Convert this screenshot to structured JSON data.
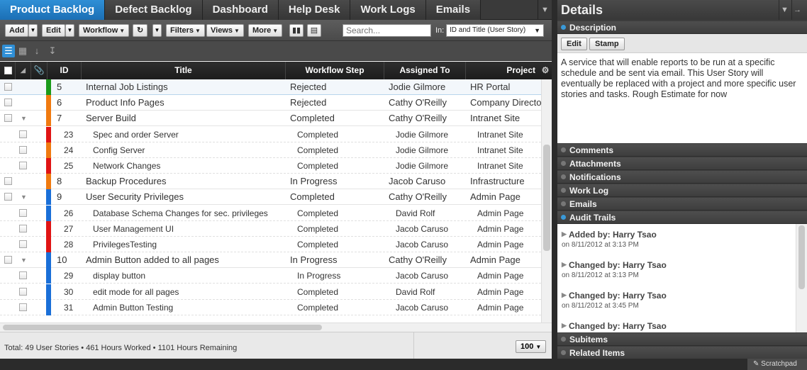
{
  "tabs": [
    {
      "label": "Product Backlog",
      "active": true
    },
    {
      "label": "Defect Backlog",
      "active": false
    },
    {
      "label": "Dashboard",
      "active": false
    },
    {
      "label": "Help Desk",
      "active": false
    },
    {
      "label": "Work Logs",
      "active": false
    },
    {
      "label": "Emails",
      "active": false
    }
  ],
  "toolbar": {
    "add": "Add",
    "edit": "Edit",
    "workflow": "Workflow",
    "filters": "Filters",
    "views": "Views",
    "more": "More",
    "search_placeholder": "Search...",
    "in_label": "In:",
    "in_value": "ID and Title (User Story)"
  },
  "columns": {
    "id": "ID",
    "title": "Title",
    "workflow": "Workflow Step",
    "assigned": "Assigned To",
    "project": "Project"
  },
  "rows": [
    {
      "id": "5",
      "title": "Internal Job Listings",
      "step": "Rejected",
      "assigned": "Jodie Gilmore",
      "project": "HR Portal",
      "color": "#1a9a1a",
      "child": false,
      "expandable": false,
      "selected": true
    },
    {
      "id": "6",
      "title": "Product Info Pages",
      "step": "Rejected",
      "assigned": "Cathy O'Reilly",
      "project": "Company Directo",
      "color": "#f07a10",
      "child": false,
      "expandable": false,
      "selected": false
    },
    {
      "id": "7",
      "title": "Server Build",
      "step": "Completed",
      "assigned": "Cathy O'Reilly",
      "project": "Intranet Site",
      "color": "#f07a10",
      "child": false,
      "expandable": true,
      "selected": false
    },
    {
      "id": "23",
      "title": "Spec and order Server",
      "step": "Completed",
      "assigned": "Jodie Gilmore",
      "project": "Intranet Site",
      "color": "#e01414",
      "child": true,
      "expandable": false,
      "selected": false
    },
    {
      "id": "24",
      "title": "Config Server",
      "step": "Completed",
      "assigned": "Jodie Gilmore",
      "project": "Intranet Site",
      "color": "#f07a10",
      "child": true,
      "expandable": false,
      "selected": false
    },
    {
      "id": "25",
      "title": "Network Changes",
      "step": "Completed",
      "assigned": "Jodie Gilmore",
      "project": "Intranet Site",
      "color": "#e01414",
      "child": true,
      "expandable": false,
      "selected": false
    },
    {
      "id": "8",
      "title": "Backup Procedures",
      "step": "In Progress",
      "assigned": "Jacob Caruso",
      "project": "Infrastructure",
      "color": "#f07a10",
      "child": false,
      "expandable": false,
      "selected": false
    },
    {
      "id": "9",
      "title": "User Security Privileges",
      "step": "Completed",
      "assigned": "Cathy O'Reilly",
      "project": "Admin Page",
      "color": "#1a6fd8",
      "child": false,
      "expandable": true,
      "selected": false
    },
    {
      "id": "26",
      "title": "Database Schema Changes for sec. privileges",
      "step": "Completed",
      "assigned": "David Rolf",
      "project": "Admin Page",
      "color": "#1a6fd8",
      "child": true,
      "expandable": false,
      "selected": false
    },
    {
      "id": "27",
      "title": "User Management UI",
      "step": "Completed",
      "assigned": "Jacob Caruso",
      "project": "Admin Page",
      "color": "#e01414",
      "child": true,
      "expandable": false,
      "selected": false
    },
    {
      "id": "28",
      "title": "PrivilegesTesting",
      "step": "Completed",
      "assigned": "Jacob Caruso",
      "project": "Admin Page",
      "color": "#e01414",
      "child": true,
      "expandable": false,
      "selected": false
    },
    {
      "id": "10",
      "title": "Admin Button added to all pages",
      "step": "In Progress",
      "assigned": "Cathy O'Reilly",
      "project": "Admin Page",
      "color": "#1a6fd8",
      "child": false,
      "expandable": true,
      "selected": false
    },
    {
      "id": "29",
      "title": "display button",
      "step": "In Progress",
      "assigned": "Jacob Caruso",
      "project": "Admin Page",
      "color": "#1a6fd8",
      "child": true,
      "expandable": false,
      "selected": false
    },
    {
      "id": "30",
      "title": "edit mode for all pages",
      "step": "Completed",
      "assigned": "David Rolf",
      "project": "Admin Page",
      "color": "#1a6fd8",
      "child": true,
      "expandable": false,
      "selected": false
    },
    {
      "id": "31",
      "title": "Admin Button Testing",
      "step": "Completed",
      "assigned": "Jacob Caruso",
      "project": "Admin Page",
      "color": "#1a6fd8",
      "child": true,
      "expandable": false,
      "selected": false
    }
  ],
  "footer": {
    "summary": "Total: 49 User Stories • 461 Hours Worked • 1101 Hours Remaining",
    "page_size": "100"
  },
  "details": {
    "title": "Details",
    "description_label": "Description",
    "edit": "Edit",
    "stamp": "Stamp",
    "description_text": "A service that will enable reports to be run at a specific schedule and be sent via email. This User Story will eventually be replaced with a project and more specific user stories and tasks. Rough Estimate for now",
    "sections": [
      "Comments",
      "Attachments",
      "Notifications",
      "Work Log",
      "Emails"
    ],
    "audit_label": "Audit Trails",
    "audit": [
      {
        "who": "Added by: Harry Tsao",
        "when": "on 8/11/2012 at 3:13 PM"
      },
      {
        "who": "Changed by: Harry Tsao",
        "when": "on 8/11/2012 at 3:13 PM"
      },
      {
        "who": "Changed by: Harry Tsao",
        "when": "on 8/11/2012 at 3:45 PM"
      },
      {
        "who": "Changed by: Harry Tsao",
        "when": ""
      }
    ],
    "subitems": "Subitems",
    "related": "Related Items",
    "scratchpad": "Scratchpad"
  }
}
